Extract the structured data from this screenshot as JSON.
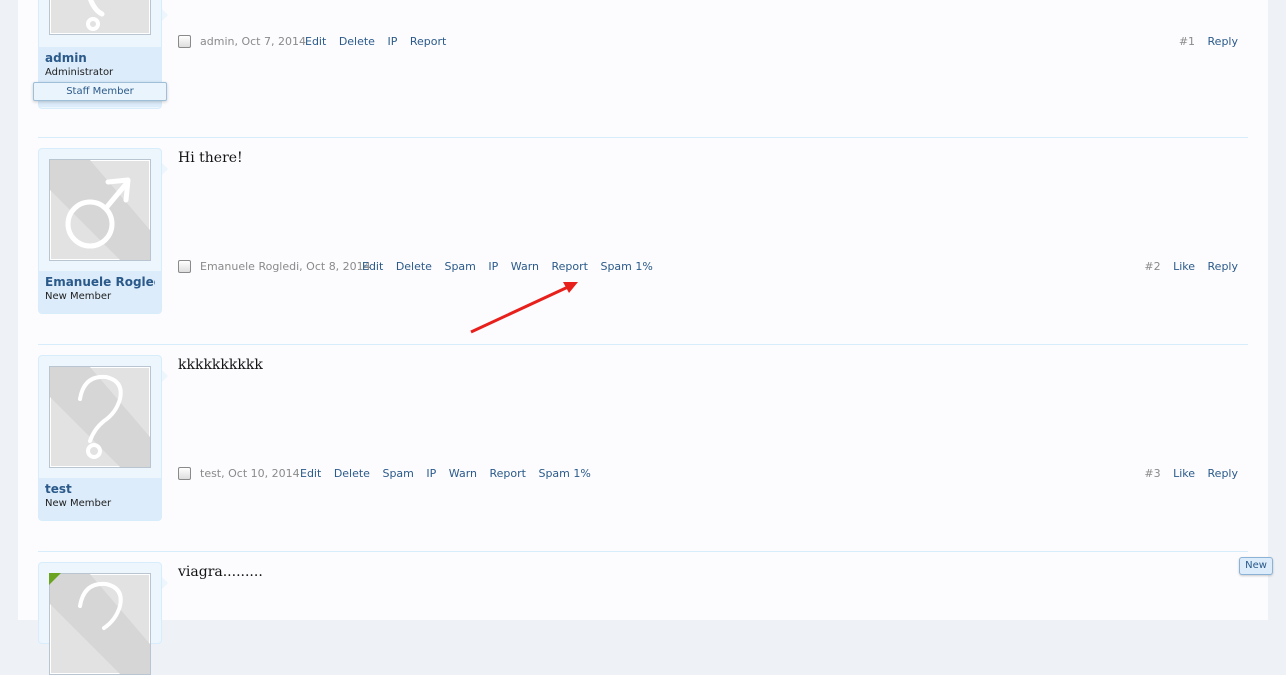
{
  "posts": [
    {
      "username": "admin",
      "usertitle": "Administrator",
      "badge": "Staff Member",
      "message": "",
      "author": "admin,",
      "date": "Oct 7, 2014",
      "controls": [
        "Edit",
        "Delete",
        "IP",
        "Report"
      ],
      "post_number": "#1",
      "right_controls": [
        "Reply"
      ]
    },
    {
      "username": "Emanuele Rogledi",
      "usertitle": "New Member",
      "message": "Hi there!",
      "author": "Emanuele Rogledi,",
      "date": "Oct 8, 2014",
      "controls": [
        "Edit",
        "Delete",
        "Spam",
        "IP",
        "Warn",
        "Report",
        "Spam 1%"
      ],
      "post_number": "#2",
      "right_controls": [
        "Like",
        "Reply"
      ]
    },
    {
      "username": "test",
      "usertitle": "New Member",
      "message": "kkkkkkkkkk",
      "author": "test,",
      "date": "Oct 10, 2014",
      "controls": [
        "Edit",
        "Delete",
        "Spam",
        "IP",
        "Warn",
        "Report",
        "Spam 1%"
      ],
      "post_number": "#3",
      "right_controls": [
        "Like",
        "Reply"
      ]
    },
    {
      "message": "viagra........."
    }
  ],
  "new_tab": "New",
  "colors": {
    "link": "#2b5a8a",
    "annotation_arrow": "#e8201c",
    "online_flag": "#6aa420"
  },
  "icons": {
    "male_avatar": "male-symbol-icon",
    "unknown_avatar": "question-mark-icon"
  }
}
